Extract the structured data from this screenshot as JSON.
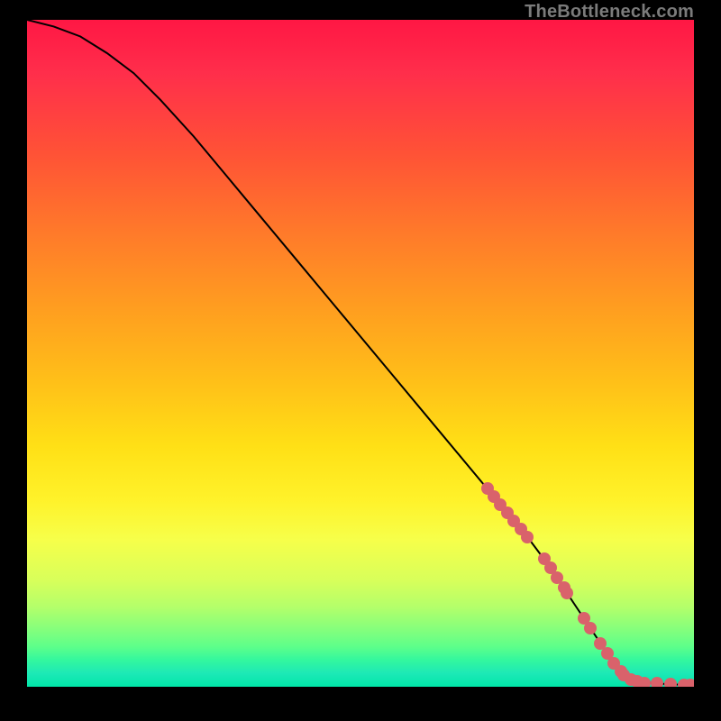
{
  "watermark": "TheBottleneck.com",
  "colors": {
    "dot": "#d9626b",
    "curve": "#000000",
    "frame": "#000000"
  },
  "chart_data": {
    "type": "line",
    "title": "",
    "xlabel": "",
    "ylabel": "",
    "xlim": [
      0,
      100
    ],
    "ylim": [
      0,
      100
    ],
    "grid": false,
    "series": [
      {
        "name": "curve",
        "x": [
          0,
          4,
          8,
          12,
          16,
          20,
          25,
          30,
          35,
          40,
          45,
          50,
          55,
          60,
          65,
          70,
          75,
          78,
          80,
          82,
          84,
          86,
          88,
          90,
          92,
          94,
          96,
          98,
          100
        ],
        "y": [
          100,
          99,
          97.5,
          95,
          92,
          88,
          82.5,
          76.5,
          70.5,
          64.5,
          58.5,
          52.5,
          46.5,
          40.5,
          34.5,
          28.5,
          22.5,
          18.5,
          15.5,
          12.5,
          9.5,
          6.5,
          3.5,
          1.5,
          0.8,
          0.5,
          0.4,
          0.3,
          0.3
        ]
      }
    ],
    "scatter": [
      {
        "name": "highlighted-points",
        "x": [
          69.0,
          70.0,
          71.0,
          72.0,
          73.0,
          74.0,
          75.0,
          77.5,
          78.5,
          79.5,
          80.5,
          81.0,
          83.5,
          84.5,
          86.0,
          87.0,
          88.0,
          89.0,
          89.5,
          90.5,
          91.5,
          92.5,
          94.5,
          96.5,
          98.5,
          99.5
        ],
        "y": [
          29.7,
          28.5,
          27.3,
          26.1,
          24.9,
          23.7,
          22.5,
          19.2,
          17.9,
          16.3,
          14.8,
          14.0,
          10.3,
          8.8,
          6.5,
          5.0,
          3.5,
          2.3,
          1.7,
          1.1,
          0.8,
          0.6,
          0.5,
          0.4,
          0.3,
          0.3
        ]
      }
    ]
  }
}
